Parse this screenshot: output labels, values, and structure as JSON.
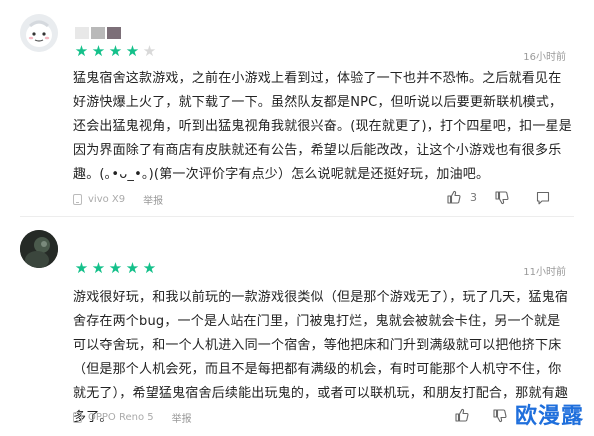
{
  "reviews": [
    {
      "username_colors": [
        "#e8e8e8",
        "#b9b9b9",
        "#7c6f78"
      ],
      "rating": 4,
      "max_rating": 5,
      "time": "16小时前",
      "text": "猛鬼宿舍这款游戏，之前在小游戏上看到过，体验了一下也并不恐怖。之后就看见在好游快爆上火了，就下载了一下。虽然队友都是NPC，但听说以后要更新联机模式，还会出猛鬼视角，听到出猛鬼视角我就很兴奋。(现在就更了)，打个四星吧，扣一星是因为界面除了有商店有皮肤就还有公告，希望以后能改改，让这个小游戏也有很多乐趣。(｡•ᴗ_•｡)(第一次评价字有点少）怎么说呢就是还挺好玩，加油吧。",
      "device": "vivo X9",
      "report": "举报",
      "likes": "3",
      "star_color": "#14c08a",
      "empty_star_color": "#d9d9d9"
    },
    {
      "rating": 5,
      "max_rating": 5,
      "time": "11小时前",
      "text": "游戏很好玩，和我以前玩的一款游戏很类似（但是那个游戏无了），玩了几天，猛鬼宿舍存在两个bug，一个是人站在门里，门被鬼打烂，鬼就会被就会卡住，另一个就是可以夺舍玩，和一个人机进入同一个宿舍，等他把床和门升到满级就可以把他挤下床（但是那个人机会死，而且不是每把都有满级的机会，有时可能那个人机守不住，你就无了），希望猛鬼宿舍后续能出玩鬼的，或者可以联机玩，和朋友打配合，那就有趣多了。",
      "device": "OPPO Reno 5",
      "report": "举报",
      "star_color": "#14c08a"
    }
  ],
  "watermark": "欧漫露"
}
